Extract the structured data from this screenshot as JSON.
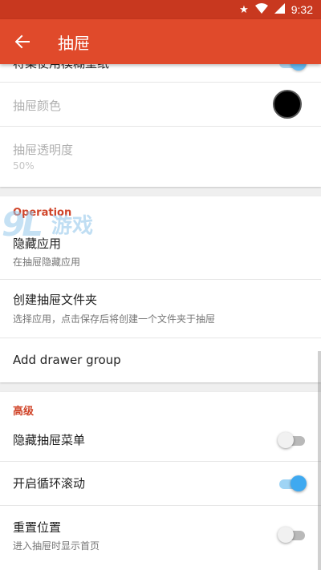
{
  "status_bar": {
    "star_icon": "star-icon",
    "wifi_icon": "wifi-icon",
    "time": "9:32"
  },
  "app_bar": {
    "title": "抽屉",
    "back_icon": "arrow-left-icon",
    "color": "#e04a2b"
  },
  "top_group": {
    "partial_row_label": "将菜使用模糊壁纸",
    "drawer_color": {
      "label": "抽屉颜色",
      "swatch_color": "#000000"
    },
    "drawer_opacity": {
      "label": "抽屉透明度",
      "value": "50%"
    }
  },
  "operation": {
    "header": "Operation",
    "hide_apps": {
      "label": "隐藏应用",
      "summary": "在抽屉隐藏应用"
    },
    "create_folder": {
      "label": "创建抽屉文件夹",
      "summary": "选择应用，点击保存后将创建一个文件夹于抽屉"
    },
    "add_group": {
      "label": "Add drawer group"
    }
  },
  "advanced": {
    "header": "高级",
    "hide_menu": {
      "label": "隐藏抽屉菜单",
      "enabled": false
    },
    "loop_scroll": {
      "label": "开启循环滚动",
      "enabled": true
    },
    "reset_position": {
      "label": "重置位置",
      "summary": "进入抽屉时显示首页",
      "enabled": false
    }
  },
  "watermark": {
    "number": "9L",
    "text": "游戏"
  },
  "accent_color": "#3fa9f0",
  "section_color": "#d0452a"
}
